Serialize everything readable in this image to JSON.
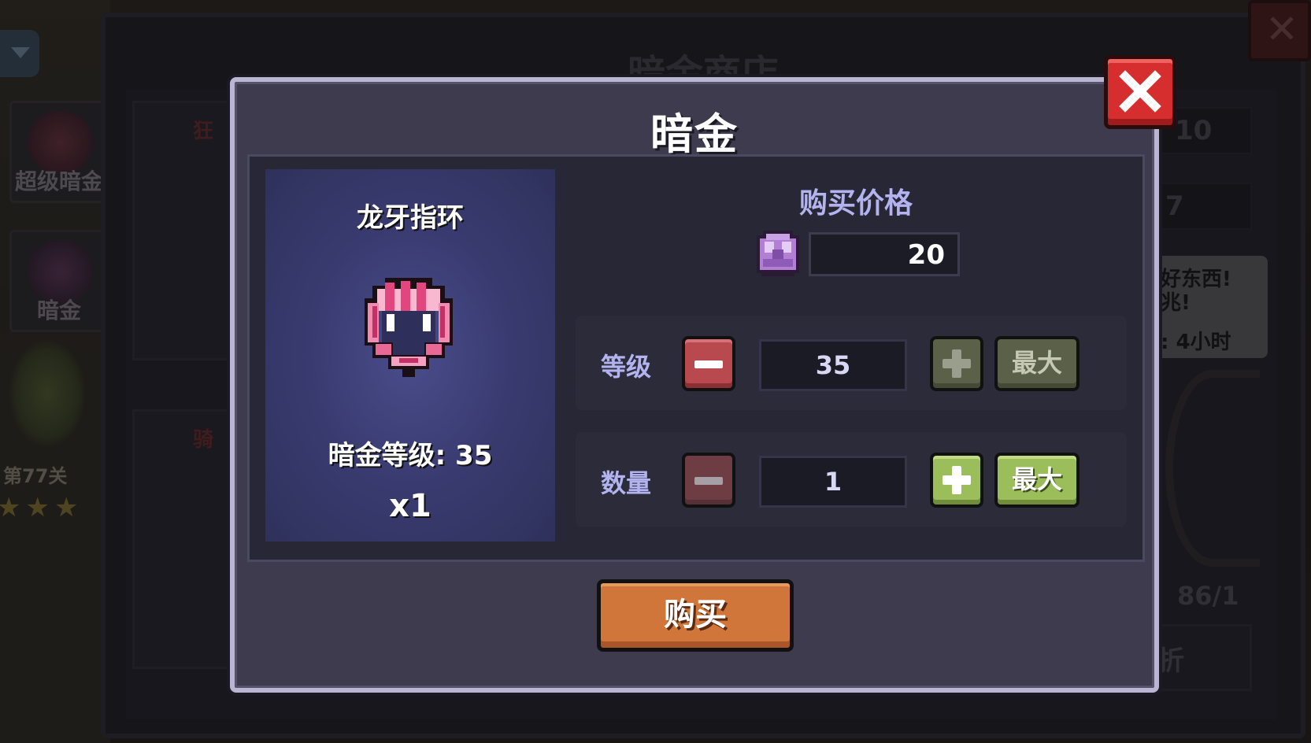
{
  "background": {
    "shop_title": "暗金商店",
    "tabs": [
      {
        "label": "超级暗金"
      },
      {
        "label": "暗金"
      }
    ],
    "stage_label": "第77关",
    "stars": "★★★",
    "card_labels": [
      "狂",
      "骑"
    ],
    "right_numbers": [
      "10",
      "7"
    ],
    "speech": {
      "line1": "好东西!",
      "line2": "兆!",
      "line3": ": 4小时"
    },
    "right_count": "86/1",
    "right_button": "折"
  },
  "dialog": {
    "title": "暗金",
    "item": {
      "name": "龙牙指环",
      "level_text": "暗金等级: 35",
      "quantity_text": "x1"
    },
    "price": {
      "title": "购买价格",
      "value": "20",
      "currency_icon": "dark-gold-crystal-icon"
    },
    "level_row": {
      "label": "等级",
      "value": "35",
      "max_label": "最大",
      "minus_enabled": true,
      "plus_enabled": false
    },
    "quantity_row": {
      "label": "数量",
      "value": "1",
      "max_label": "最大",
      "minus_enabled": false,
      "plus_enabled": true
    },
    "buy_label": "购买"
  },
  "colors": {
    "modal_border": "#b9b5d2",
    "buy_button": "#d0763a",
    "close_button": "#d62e2e",
    "label_text": "#b3b3f0"
  }
}
